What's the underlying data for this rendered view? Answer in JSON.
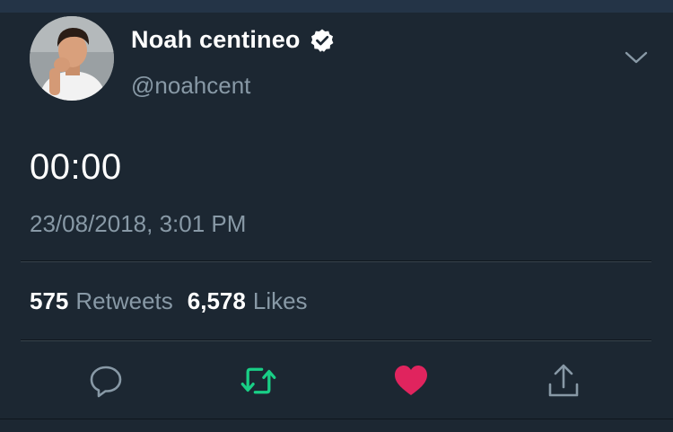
{
  "author": {
    "display_name": "Noah centineo",
    "handle": "@noahcent",
    "verified": true
  },
  "tweet": {
    "text": "00:00",
    "timestamp": "23/08/2018, 3:01 PM"
  },
  "stats": {
    "retweets_count": "575",
    "retweets_label": "Retweets",
    "likes_count": "6,578",
    "likes_label": "Likes"
  },
  "actions": {
    "reply_icon": "reply-icon",
    "retweet_icon": "retweet-icon",
    "like_icon": "like-icon",
    "share_icon": "share-icon",
    "retweeted": true,
    "liked": true
  },
  "colors": {
    "background": "#1c2732",
    "text_primary": "#ffffff",
    "text_secondary": "#8899a6",
    "retweet_active": "#19cf86",
    "like_active": "#e0245e"
  }
}
